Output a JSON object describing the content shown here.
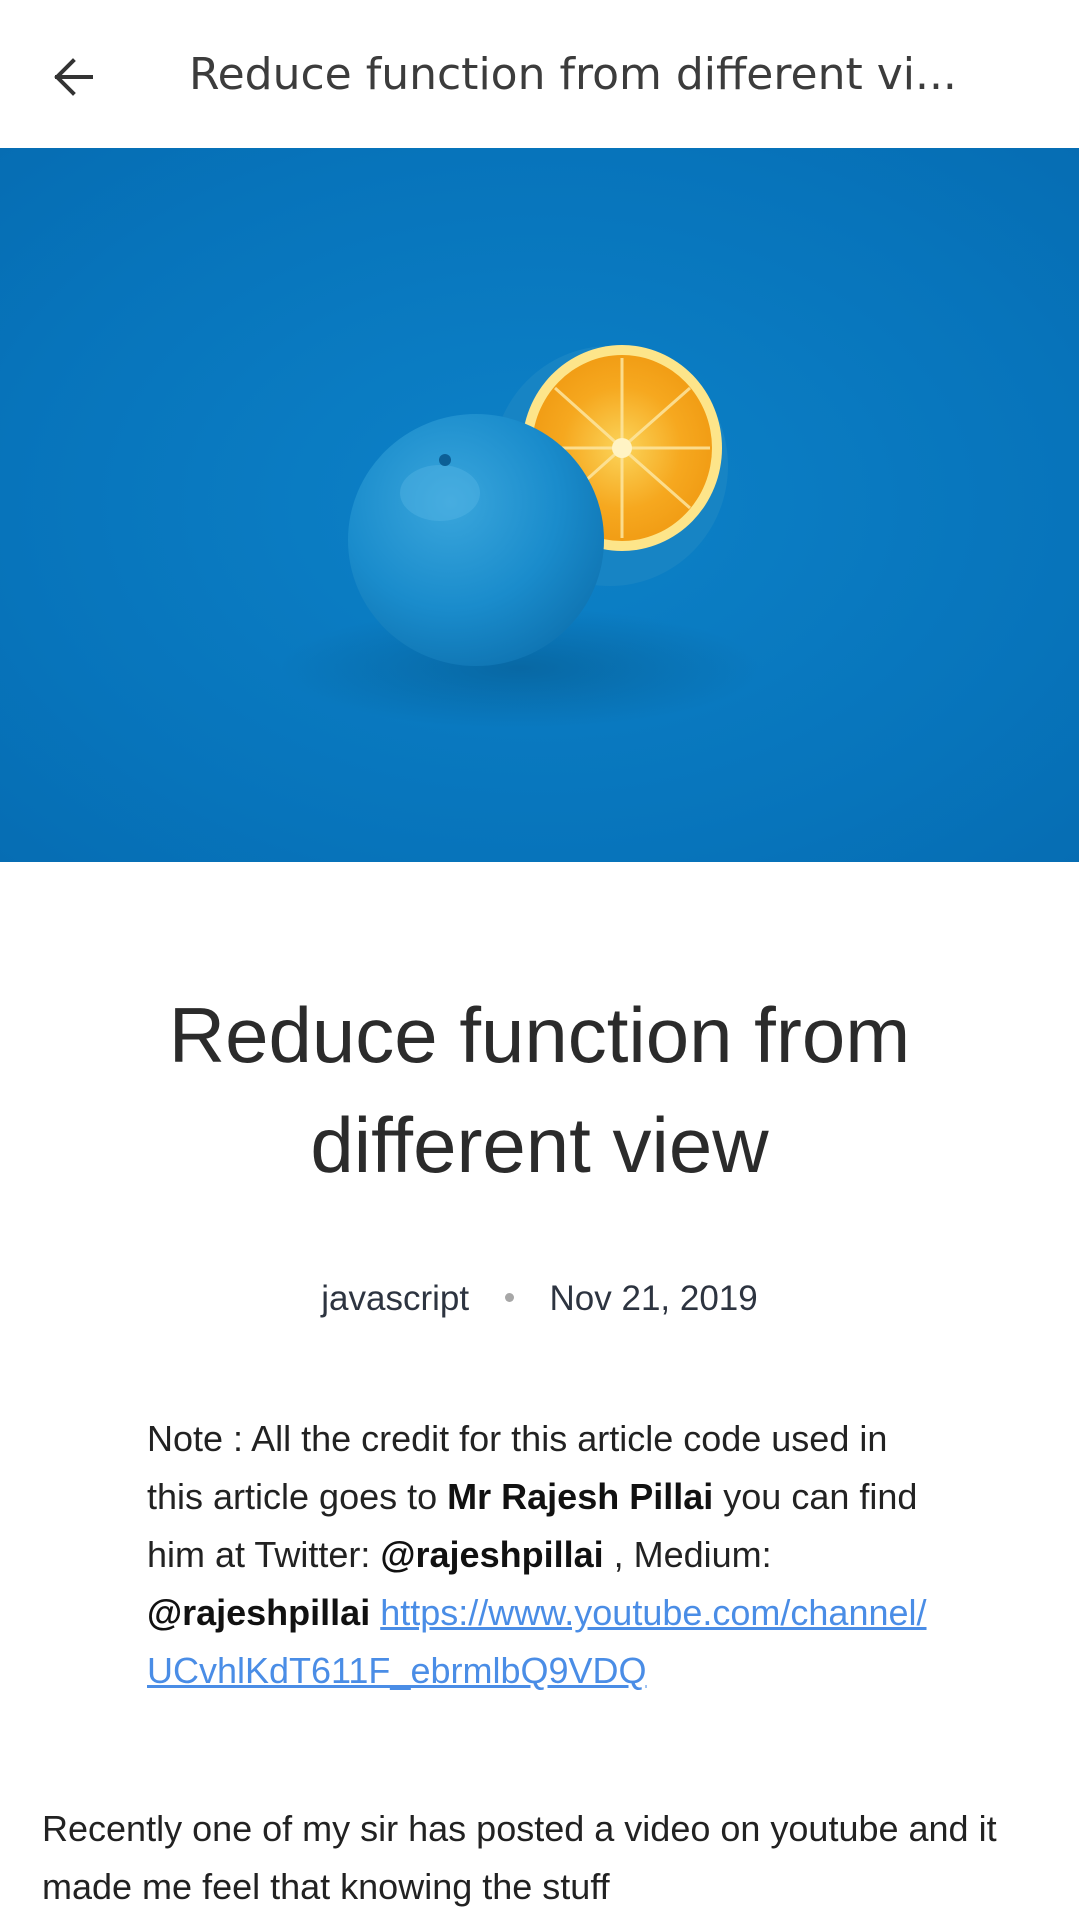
{
  "app_bar": {
    "title": "Reduce function from different vi...",
    "back_icon": "arrow-left-icon"
  },
  "hero_image": {
    "description_icon": "orange-image",
    "background_color": "#0774bb"
  },
  "article": {
    "title": "Reduce function from different view",
    "tag": "javascript",
    "date": "Nov 21, 2019",
    "note": {
      "part1": "Note : All the credit for this article  code used in this article goes to ",
      "author": "Mr Rajesh Pillai",
      "part2": " you can find him at Twitter: ",
      "twitter": "@rajeshpillai",
      "part3": "  , Medium: ",
      "medium": "@rajeshpillai",
      "link": "https://www.youtube.com/channel/UCvhlKdT611F_ebrmlbQ9VDQ"
    },
    "body": "Recently one of my sir has posted a video on youtube and it made me feel that knowing the stuff"
  },
  "colors": {
    "link": "#4a8de6",
    "text": "#222222",
    "dot": "#a7a7a7"
  }
}
